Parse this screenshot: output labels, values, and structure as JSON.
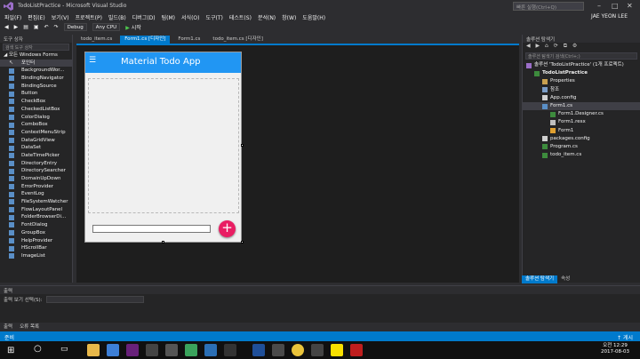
{
  "window": {
    "title": "TodoListPractice - Microsoft Visual Studio",
    "search_placeholder": "빠른 실행(Ctrl+Q)"
  },
  "menu": {
    "items": [
      "파일(F)",
      "편집(E)",
      "보기(V)",
      "프로젝트(P)",
      "빌드(B)",
      "디버그(D)",
      "팀(M)",
      "서식(O)",
      "도구(T)",
      "테스트(S)",
      "분석(N)",
      "창(W)",
      "도움말(H)"
    ],
    "user": "JAE YEON LEE"
  },
  "toolbar": {
    "config": "Debug",
    "platform": "Any CPU",
    "start": "시작"
  },
  "toolbox": {
    "title": "도구 상자",
    "search_placeholder": "검색 도구 상자",
    "group": "◢ 모든 Windows Forms",
    "items": [
      "포인터",
      "BackgroundWor...",
      "BindingNavigator",
      "BindingSource",
      "Button",
      "CheckBox",
      "CheckedListBox",
      "ColorDialog",
      "ComboBox",
      "ContextMenuStrip",
      "DataGridView",
      "DataSet",
      "DateTimePicker",
      "DirectoryEntry",
      "DirectorySearcher",
      "DomainUpDown",
      "ErrorProvider",
      "EventLog",
      "FileSystemWatcher",
      "FlowLayoutPanel",
      "FolderBrowserDi...",
      "FontDialog",
      "GroupBox",
      "HelpProvider",
      "HScrollBar",
      "ImageList"
    ]
  },
  "tabs": [
    "todo_item.cs",
    "Form1.cs [디자인]",
    "Form1.cs",
    "todo_item.cs [디자인]"
  ],
  "designer": {
    "app_title": "Material Todo App",
    "menu_glyph": "☰",
    "fab_glyph": "+"
  },
  "solution": {
    "title": "솔루션 탐색기",
    "search_placeholder": "솔루션 탐색기 검색(Ctrl+;)",
    "tree": [
      {
        "label": "솔루션 'TodoListPractice' (1개 프로젝트)",
        "indent": 0,
        "icon": "solution-icon",
        "bold": false
      },
      {
        "label": "TodoListPractice",
        "indent": 1,
        "icon": "csharp-project-icon",
        "bold": true
      },
      {
        "label": "Properties",
        "indent": 2,
        "icon": "wrench-icon",
        "bold": false
      },
      {
        "label": "참조",
        "indent": 2,
        "icon": "references-icon",
        "bold": false
      },
      {
        "label": "App.config",
        "indent": 2,
        "icon": "config-icon",
        "bold": false
      },
      {
        "label": "Form1.cs",
        "indent": 2,
        "icon": "form-icon",
        "bold": false,
        "selected": true
      },
      {
        "label": "Form1.Designer.cs",
        "indent": 3,
        "icon": "csharp-file-icon",
        "bold": false
      },
      {
        "label": "Form1.resx",
        "indent": 3,
        "icon": "resx-icon",
        "bold": false
      },
      {
        "label": "Form1",
        "indent": 3,
        "icon": "class-icon",
        "bold": false
      },
      {
        "label": "packages.config",
        "indent": 2,
        "icon": "config-icon",
        "bold": false
      },
      {
        "label": "Program.cs",
        "indent": 2,
        "icon": "csharp-file-icon",
        "bold": false
      },
      {
        "label": "todo_item.cs",
        "indent": 2,
        "icon": "csharp-file-icon",
        "bold": false
      }
    ],
    "bottom_tabs": [
      "솔루션 탐색기",
      "속성"
    ]
  },
  "output": {
    "title": "출력",
    "source_label": "출력 보기 선택(S):",
    "tabs": [
      "출력",
      "오류 목록"
    ]
  },
  "status": {
    "left": "준비",
    "right": "게시"
  },
  "taskbar": {
    "time": "오전 12:29",
    "date": "2017-08-03"
  },
  "colors": {
    "accent": "#007acc",
    "appbar": "#2196f3",
    "fab": "#e91e63"
  }
}
